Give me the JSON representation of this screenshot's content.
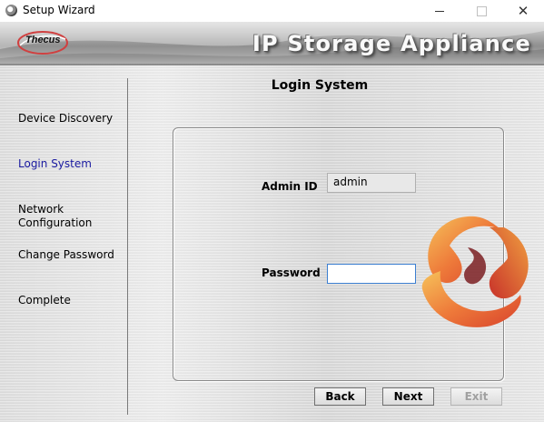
{
  "window": {
    "title": "Setup Wizard",
    "controls": {
      "minimize": "minimize-icon",
      "maximize": "maximize-icon",
      "close": "✕"
    }
  },
  "banner": {
    "logo_text": "Thecus",
    "product_title": "IP Storage Appliance"
  },
  "steps": [
    {
      "label": "Device Discovery",
      "active": false
    },
    {
      "label": "Login System",
      "active": true
    },
    {
      "label": "Network\nConfiguration",
      "active": false
    },
    {
      "label": "Change Password",
      "active": false
    },
    {
      "label": "Complete",
      "active": false
    }
  ],
  "page": {
    "heading": "Login System",
    "admin_id": {
      "label": "Admin ID",
      "value": "admin"
    },
    "password": {
      "label": "Password",
      "value": ""
    }
  },
  "buttons": {
    "back": "Back",
    "next": "Next",
    "exit": "Exit"
  },
  "colors": {
    "active_step": "#1a1aa0",
    "focus_border": "#3c7fd1"
  }
}
